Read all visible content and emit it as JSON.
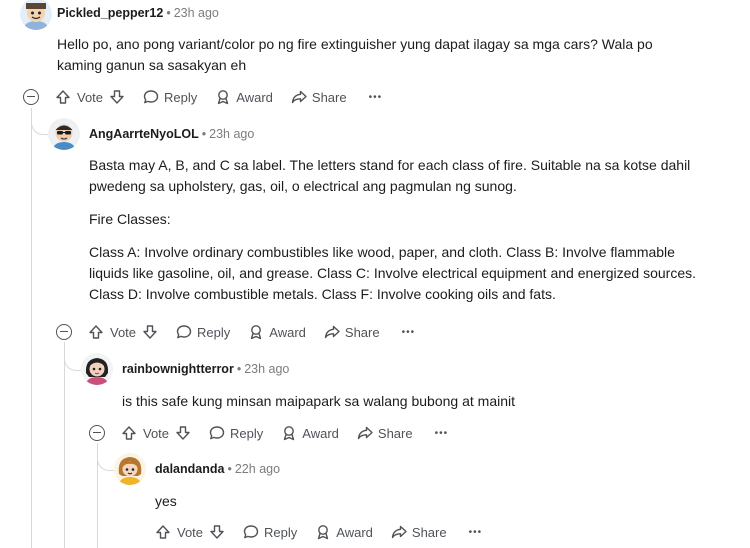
{
  "comments": [
    {
      "author": "Pickled_pepper12",
      "dot": "•",
      "time": "23h ago",
      "paragraphs": [
        "Hello po, ano pong variant/color po ng fire extinguisher yung dapat ilagay sa mga cars? Wala po kaming ganun sa sasakyan eh"
      ],
      "has_collapse": true
    },
    {
      "author": "AngAarrteNyoLOL",
      "dot": "•",
      "time": "23h ago",
      "paragraphs": [
        "Basta may A, B, and C sa label. The letters stand for each class of fire. Suitable na sa kotse dahil pwedeng sa upholstery, gas, oil, o electrical ang pagmulan ng sunog.",
        "Fire Classes:",
        "Class A: Involve ordinary combustibles like wood, paper, and cloth. Class B: Involve flammable liquids like gasoline, oil, and grease. Class C: Involve electrical equipment and energized sources. Class D: Involve combustible metals. Class F: Involve cooking oils and fats."
      ],
      "has_collapse": true
    },
    {
      "author": "rainbownightterror",
      "dot": "•",
      "time": "23h ago",
      "paragraphs": [
        "is this safe kung minsan maipapark sa walang bubong at mainit"
      ],
      "has_collapse": true
    },
    {
      "author": "dalandanda",
      "dot": "•",
      "time": "22h ago",
      "paragraphs": [
        "yes"
      ],
      "has_collapse": false
    }
  ],
  "actions": {
    "vote": "Vote",
    "reply": "Reply",
    "award": "Award",
    "share": "Share",
    "more": "•••"
  },
  "colors": {
    "text": "#1c1c1c",
    "meta": "#7c7c7c",
    "action": "#4f5358",
    "line": "#d7dadc"
  },
  "icons": [
    "upvote-icon",
    "downvote-icon",
    "reply-bubble-icon",
    "award-icon",
    "share-icon",
    "more-icon",
    "collapse-icon"
  ]
}
